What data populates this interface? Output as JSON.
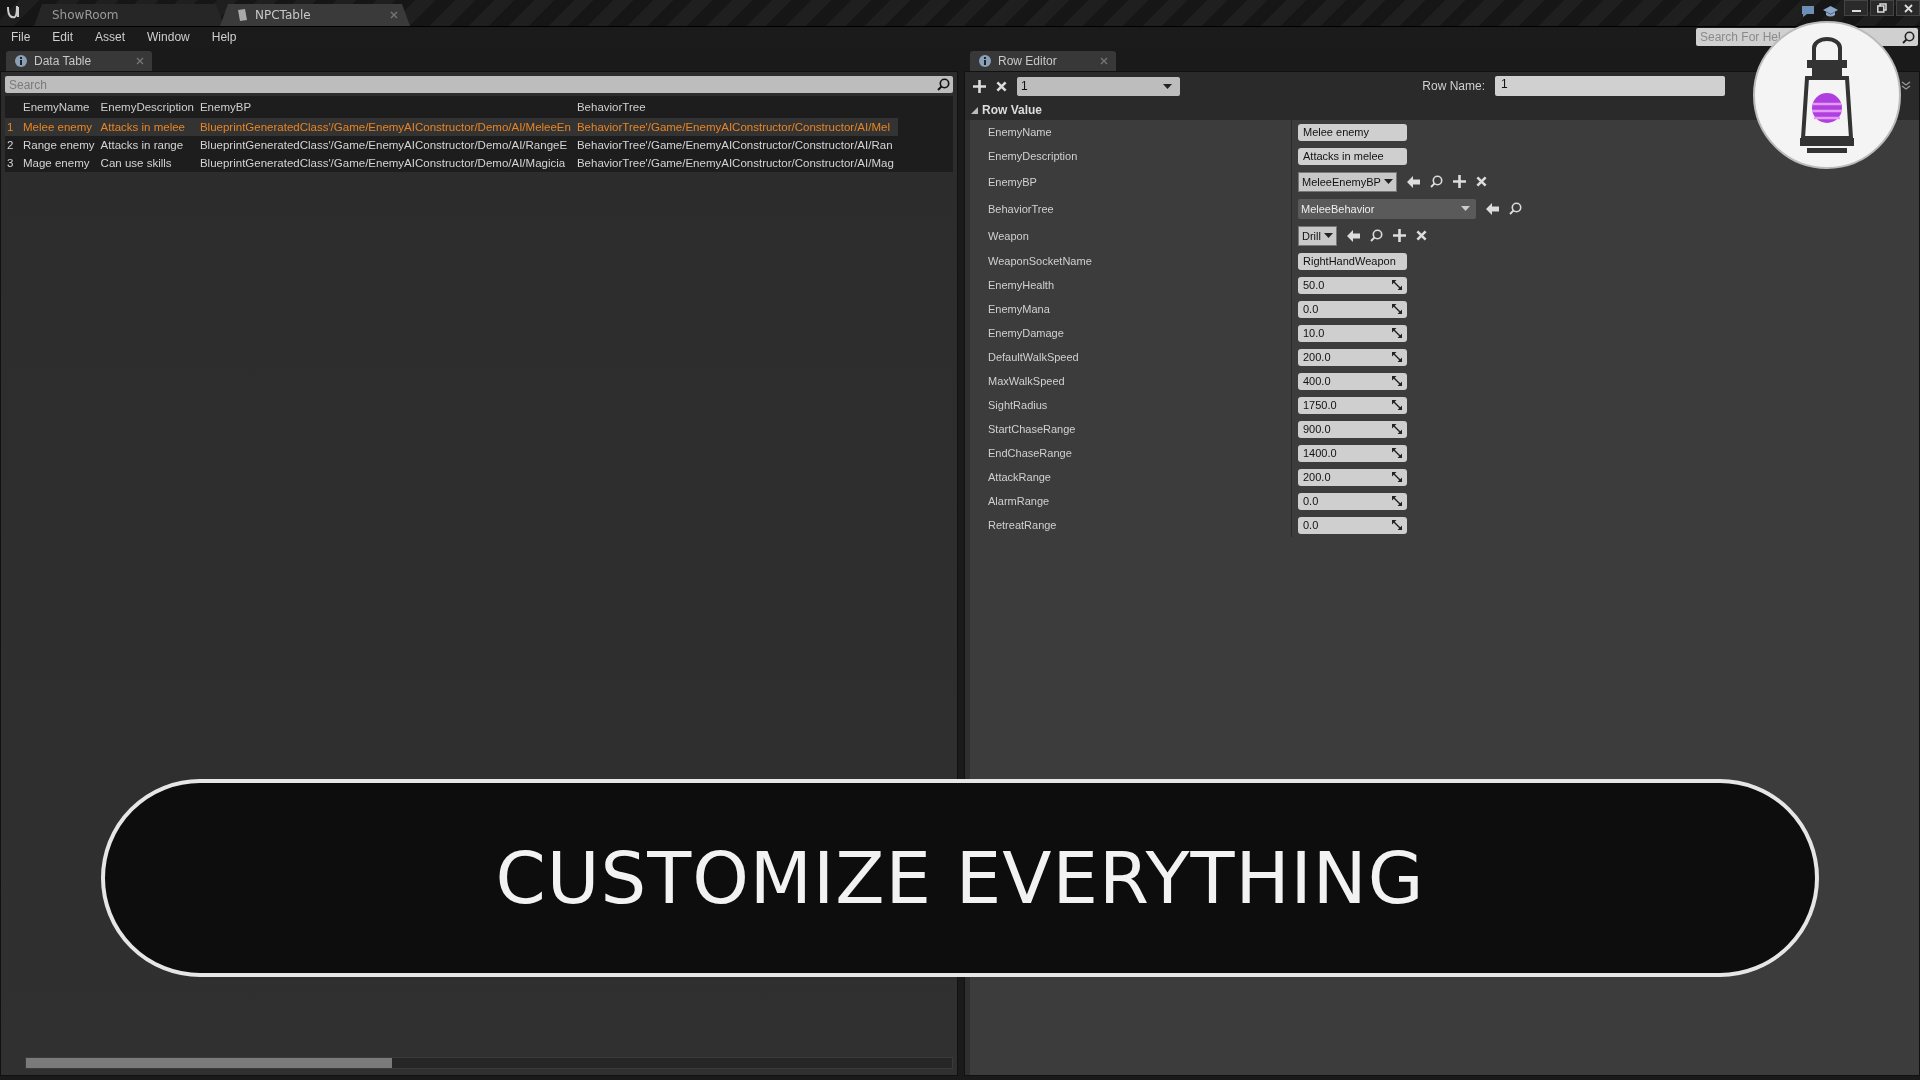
{
  "title_bar": {
    "tabs": [
      {
        "label": "ShowRoom",
        "selected": false
      },
      {
        "label": "NPCTable",
        "selected": true
      }
    ]
  },
  "menu": [
    "File",
    "Edit",
    "Asset",
    "Window",
    "Help"
  ],
  "help_search": {
    "placeholder": "Search For Hel"
  },
  "data_table": {
    "tab": "Data Table",
    "search": {
      "placeholder": "Search"
    },
    "columns": [
      "EnemyName",
      "EnemyDescription",
      "EnemyBP",
      "BehaviorTree"
    ],
    "rows": [
      {
        "index": "1",
        "selected": true,
        "cells": [
          "Melee enemy",
          "Attacks in melee",
          "BlueprintGeneratedClass'/Game/EnemyAIConstructor/Demo/AI/MeleeEn",
          "BehaviorTree'/Game/EnemyAIConstructor/Constructor/AI/Mel"
        ]
      },
      {
        "index": "2",
        "selected": false,
        "cells": [
          "Range enemy",
          "Attacks in range",
          "BlueprintGeneratedClass'/Game/EnemyAIConstructor/Demo/AI/RangeE",
          "BehaviorTree'/Game/EnemyAIConstructor/Constructor/AI/Ran"
        ]
      },
      {
        "index": "3",
        "selected": false,
        "cells": [
          "Mage enemy",
          "Can use skills",
          "BlueprintGeneratedClass'/Game/EnemyAIConstructor/Demo/AI/Magicia",
          "BehaviorTree'/Game/EnemyAIConstructor/Constructor/AI/Mag"
        ]
      }
    ]
  },
  "row_editor": {
    "tab": "Row Editor",
    "row_select": "1",
    "row_name_label": "Row Name:",
    "row_name": "1",
    "section": {
      "title": "Row Value",
      "expanded": true
    },
    "properties": [
      {
        "name": "EnemyName",
        "kind": "text",
        "value": "Melee enemy"
      },
      {
        "name": "EnemyDescription",
        "kind": "text",
        "value": "Attacks in melee"
      },
      {
        "name": "EnemyBP",
        "kind": "asset",
        "value": "MeleeEnemyBP"
      },
      {
        "name": "BehaviorTree",
        "kind": "picker",
        "value": "MeleeBehavior"
      },
      {
        "name": "Weapon",
        "kind": "asset",
        "value": "Drill"
      },
      {
        "name": "WeaponSocketName",
        "kind": "text",
        "value": "RightHandWeapon"
      },
      {
        "name": "EnemyHealth",
        "kind": "number",
        "value": "50.0"
      },
      {
        "name": "EnemyMana",
        "kind": "number",
        "value": "0.0"
      },
      {
        "name": "EnemyDamage",
        "kind": "number",
        "value": "10.0"
      },
      {
        "name": "DefaultWalkSpeed",
        "kind": "number",
        "value": "200.0"
      },
      {
        "name": "MaxWalkSpeed",
        "kind": "number",
        "value": "400.0"
      },
      {
        "name": "SightRadius",
        "kind": "number",
        "value": "1750.0"
      },
      {
        "name": "StartChaseRange",
        "kind": "number",
        "value": "900.0"
      },
      {
        "name": "EndChaseRange",
        "kind": "number",
        "value": "1400.0"
      },
      {
        "name": "AttackRange",
        "kind": "number",
        "value": "200.0"
      },
      {
        "name": "AlarmRange",
        "kind": "number",
        "value": "0.0"
      },
      {
        "name": "RetreatRange",
        "kind": "number",
        "value": "0.0"
      }
    ]
  },
  "banner": {
    "text": "CUSTOMIZE EVERYTHING"
  }
}
